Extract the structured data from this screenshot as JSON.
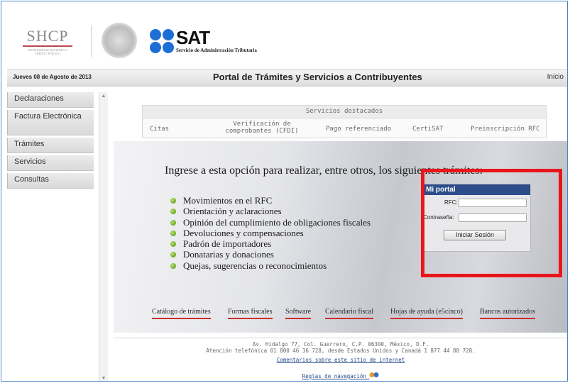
{
  "header": {
    "shcp_name": "SHCP",
    "shcp_sub": "SECRETARÍA DE HACIENDA Y CRÉDITO PÚBLICO",
    "sat_name": "SAT",
    "sat_sub": "Servicio de Administración Tributaria"
  },
  "topbar": {
    "date": "Jueves 08 de Agosto de 2013",
    "title": "Portal de Trámites y Servicios a Contribuyentes",
    "inicio": "Inicio"
  },
  "sidebar": {
    "items": [
      {
        "label": "Declaraciones"
      },
      {
        "label": "Factura Electrónica"
      },
      {
        "label": "Trámites"
      },
      {
        "label": "Servicios"
      },
      {
        "label": "Consultas"
      }
    ]
  },
  "featured": {
    "title": "Servicios destacados",
    "links": [
      {
        "label": "Citas"
      },
      {
        "label": "Verificación de comprobantes (CFDI)"
      },
      {
        "label": "Pago referenciado"
      },
      {
        "label": "CertiSAT"
      },
      {
        "label": "Preinscripción RFC"
      }
    ]
  },
  "banner": {
    "heading": "Ingrese a esta opción para realizar, entre otros, los siguientes trámites:",
    "items": [
      "Movimientos en el RFC",
      "Orientación y aclaraciones",
      "Opinión del cumplimiento de obligaciones fiscales",
      "Devoluciones y compensaciones",
      "Padrón de importadores",
      "Donatarias y donaciones",
      "Quejas, sugerencias o reconocimientos"
    ],
    "links": [
      "Catálogo de trámites",
      "Formas fiscales",
      "Software",
      "Calendario fiscal",
      "Hojas de ayuda (e5cinco)",
      "Bancos autorizados"
    ]
  },
  "login": {
    "title": "Mi portal",
    "rfc_label": "RFC:",
    "rfc_value": "",
    "password_label": "Contraseña:",
    "password_value": "",
    "submit_label": "Iniciar Sesión"
  },
  "footer": {
    "address": "Av. Hidalgo 77, Col. Guerrero, C.P. 06300, México, D.F.",
    "phone": "Atención telefónica 01 800 46 36 728, desde Estados Unidos y Canadá 1 877 44 88 728.",
    "comments_link": "Comentarios sobre este sitio de internet",
    "rules_link": "Reglas de navegación"
  },
  "colors": {
    "highlight": "#e8161b",
    "login_header": "#2d4d8a",
    "bullet": "#6aa81f",
    "link_underline": "#c9302c"
  }
}
